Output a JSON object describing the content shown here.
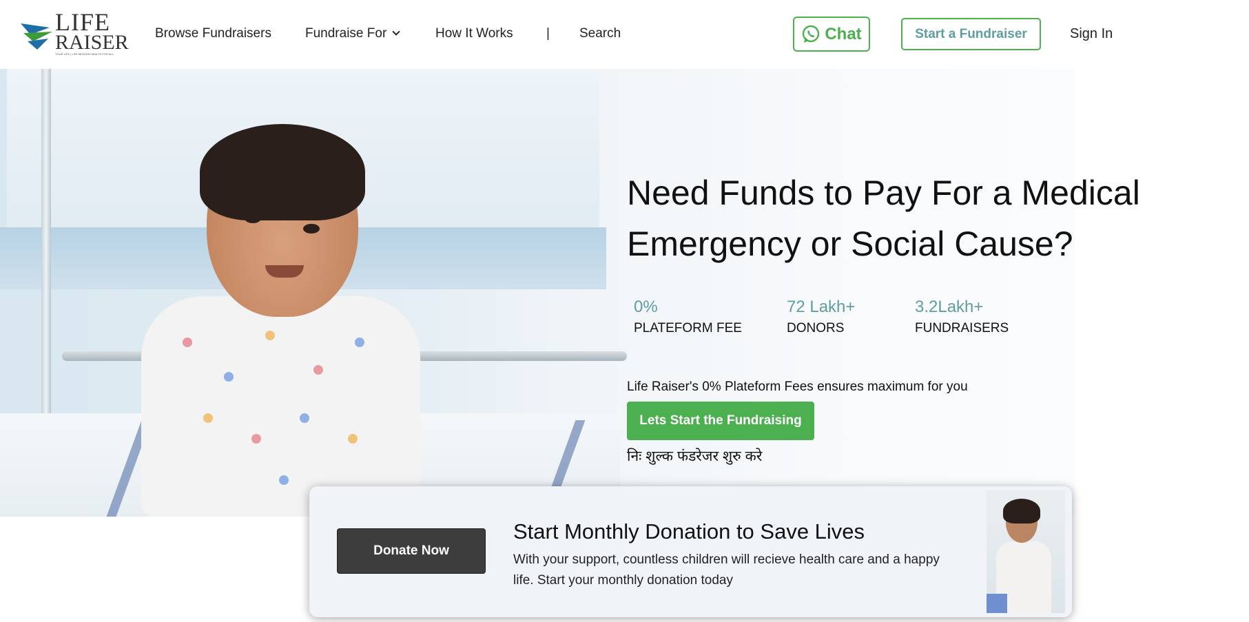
{
  "brand": {
    "name_line1": "LIFE",
    "name_line2": "RAISER",
    "tagline": "YOUR LIFE | LIFE MISSION HEALTH FOR ALL"
  },
  "nav": {
    "browse": "Browse Fundraisers",
    "fundraise_for": "Fundraise For",
    "how_it_works": "How It Works",
    "divider": "|",
    "search": "Search",
    "chat": "Chat",
    "start_fundraiser": "Start a Fundraiser",
    "sign_in": "Sign In"
  },
  "hero": {
    "title_line1": "Need Funds to Pay For a Medical",
    "title_line2": "Emergency or Social Cause?",
    "stats": [
      {
        "value": "0%",
        "label": "PLATEFORM FEE"
      },
      {
        "value": "72 Lakh+",
        "label": "DONORS"
      },
      {
        "value": "3.2Lakh+",
        "label": "FUNDRAISERS"
      }
    ],
    "fees_text": "Life Raiser's 0% Plateform Fees ensures maximum for you",
    "cta": "Lets Start the Fundraising",
    "hindi_text": "निः शुल्क फंडरेजर शुरु करे"
  },
  "donation_card": {
    "button": "Donate Now",
    "title": "Start Monthly Donation to Save Lives",
    "description": "With your support, countless children will recieve health care and a happy life. Start your monthly donation today"
  },
  "colors": {
    "accent_green": "#4caf50",
    "stat_teal": "#5f9ea0",
    "dark_button": "#3d3d3d"
  }
}
